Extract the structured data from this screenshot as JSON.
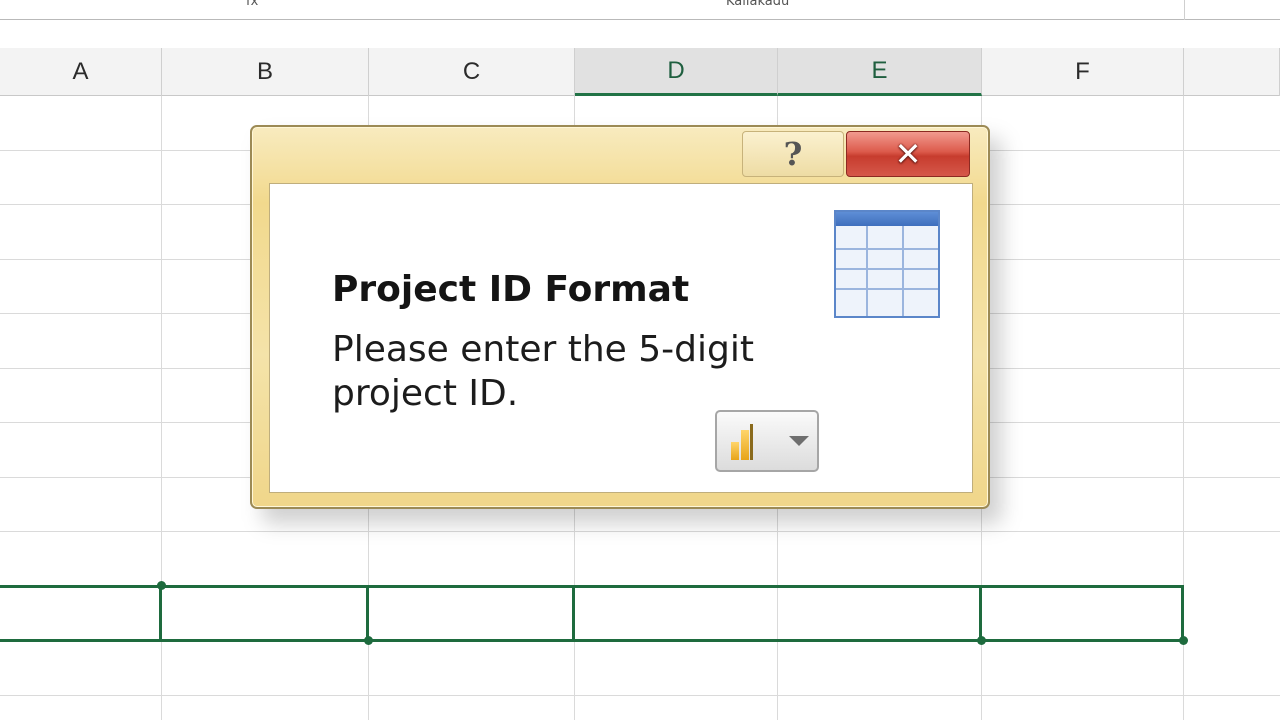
{
  "top_strip": {
    "left_text": "fx",
    "right_text": "Kaliakadu"
  },
  "columns": [
    "A",
    "B",
    "C",
    "D",
    "E",
    "F",
    ""
  ],
  "selected_column": "D",
  "dialog": {
    "help_glyph": "?",
    "close_glyph": "✕",
    "title": "Project ID Format",
    "message": "Please enter the 5-digit project ID.",
    "icons": {
      "table": "table-grid-icon",
      "dropdown": "chart-dropdown-icon"
    }
  },
  "colors": {
    "selection_green": "#1e6b3e",
    "dialog_gold": "#f2d98d",
    "close_red": "#c73c2e",
    "table_blue": "#5b86c9"
  }
}
